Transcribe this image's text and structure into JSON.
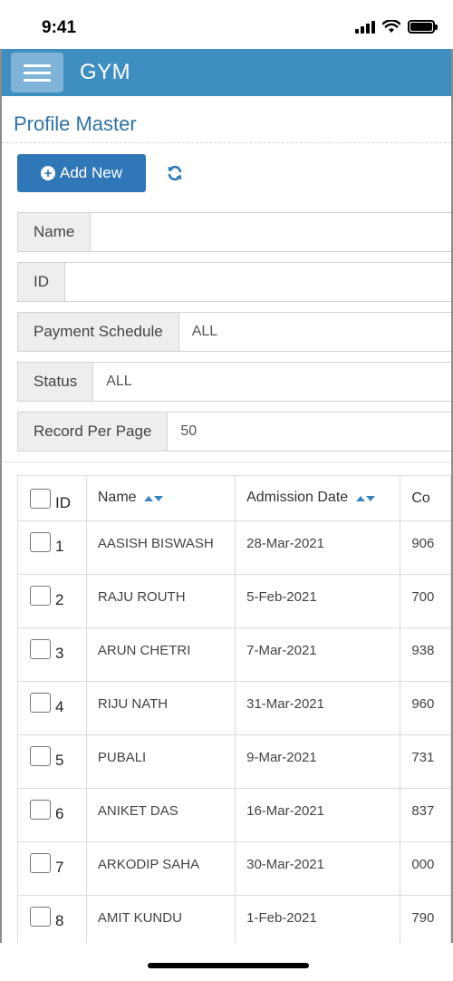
{
  "status_bar": {
    "time": "9:41"
  },
  "navbar": {
    "brand": "GYM"
  },
  "page": {
    "title": "Profile Master"
  },
  "toolbar": {
    "add_label": "Add New"
  },
  "filters": [
    {
      "label": "Name",
      "value": ""
    },
    {
      "label": "ID",
      "value": ""
    },
    {
      "label": "Payment Schedule",
      "value": "ALL"
    },
    {
      "label": "Status",
      "value": "ALL"
    },
    {
      "label": "Record Per Page",
      "value": "50"
    }
  ],
  "table": {
    "columns": [
      "ID",
      "Name",
      "Admission Date",
      "Co"
    ],
    "rows": [
      {
        "id": "1",
        "name": "AASISH BISWASH",
        "date": "28-Mar-2021",
        "contact": "906"
      },
      {
        "id": "2",
        "name": "RAJU ROUTH",
        "date": "5-Feb-2021",
        "contact": "700"
      },
      {
        "id": "3",
        "name": "ARUN CHETRI",
        "date": "7-Mar-2021",
        "contact": "938"
      },
      {
        "id": "4",
        "name": "RIJU NATH",
        "date": "31-Mar-2021",
        "contact": "960"
      },
      {
        "id": "5",
        "name": "PUBALI",
        "date": "9-Mar-2021",
        "contact": "731"
      },
      {
        "id": "6",
        "name": "ANIKET DAS",
        "date": "16-Mar-2021",
        "contact": "837"
      },
      {
        "id": "7",
        "name": "ARKODIP SAHA",
        "date": "30-Mar-2021",
        "contact": "000"
      },
      {
        "id": "8",
        "name": "AMIT KUNDU",
        "date": "1-Feb-2021",
        "contact": "790"
      }
    ]
  },
  "colors": {
    "navbar": "#3f8ec2",
    "accent": "#2f77b7",
    "title": "#2f72a8"
  },
  "icons": {
    "menu": "hamburger-icon",
    "add": "plus-circle-icon",
    "refresh": "refresh-icon",
    "sort": "sort-icon"
  }
}
